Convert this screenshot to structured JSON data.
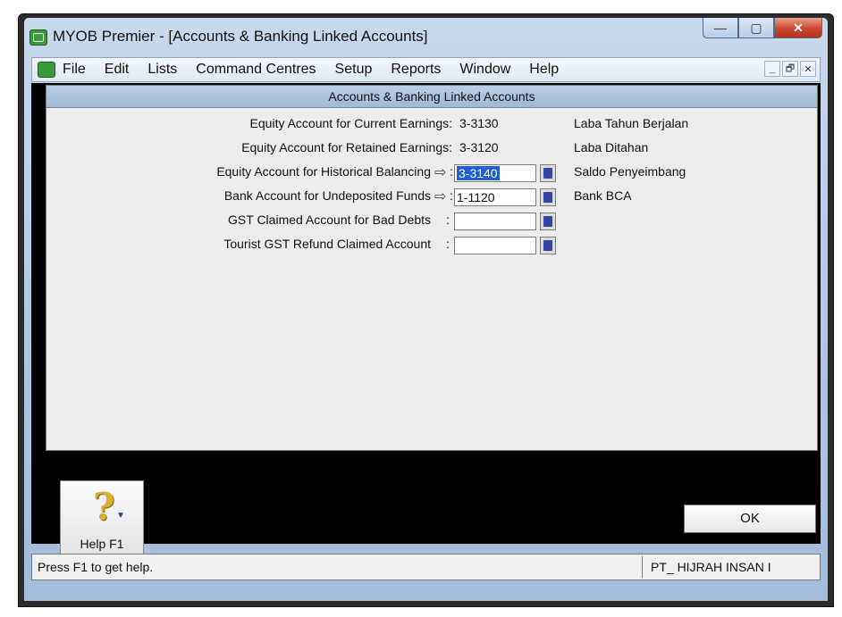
{
  "window": {
    "title": "MYOB Premier - [Accounts & Banking Linked Accounts]",
    "caption_buttons": {
      "minimize": "—",
      "maximize": "▢",
      "close": "✕"
    }
  },
  "menu": {
    "items": [
      "File",
      "Edit",
      "Lists",
      "Command Centres",
      "Setup",
      "Reports",
      "Window",
      "Help"
    ],
    "mdi_buttons": {
      "minimize": "_",
      "restore": "🗗",
      "close": "✕"
    }
  },
  "panel": {
    "header": "Accounts & Banking Linked Accounts",
    "rows": [
      {
        "label": "Equity Account for Current Earnings:",
        "value": "3-3130",
        "description": "Laba Tahun Berjalan"
      },
      {
        "label": "Equity Account for Retained Earnings:",
        "value": "3-3120",
        "description": "Laba Ditahan"
      },
      {
        "label": "Equity Account for Historical Balancing",
        "value": "3-3140",
        "description": "Saldo Penyeimbang"
      },
      {
        "label": "Bank Account for Undeposited Funds",
        "value": "1-1120",
        "description": "Bank BCA"
      },
      {
        "label": "GST Claimed Account for Bad Debts",
        "value": "",
        "description": ""
      },
      {
        "label": "Tourist GST Refund Claimed Account",
        "value": "",
        "description": ""
      }
    ],
    "arrow_glyph": "⇨",
    "colon": ":"
  },
  "buttons": {
    "help_label": "Help F1",
    "help_symbol": "?",
    "help_caret": "▼",
    "ok_label": "OK"
  },
  "status": {
    "left": "Press F1 to get help.",
    "right": "PT_ HIJRAH INSAN I"
  }
}
